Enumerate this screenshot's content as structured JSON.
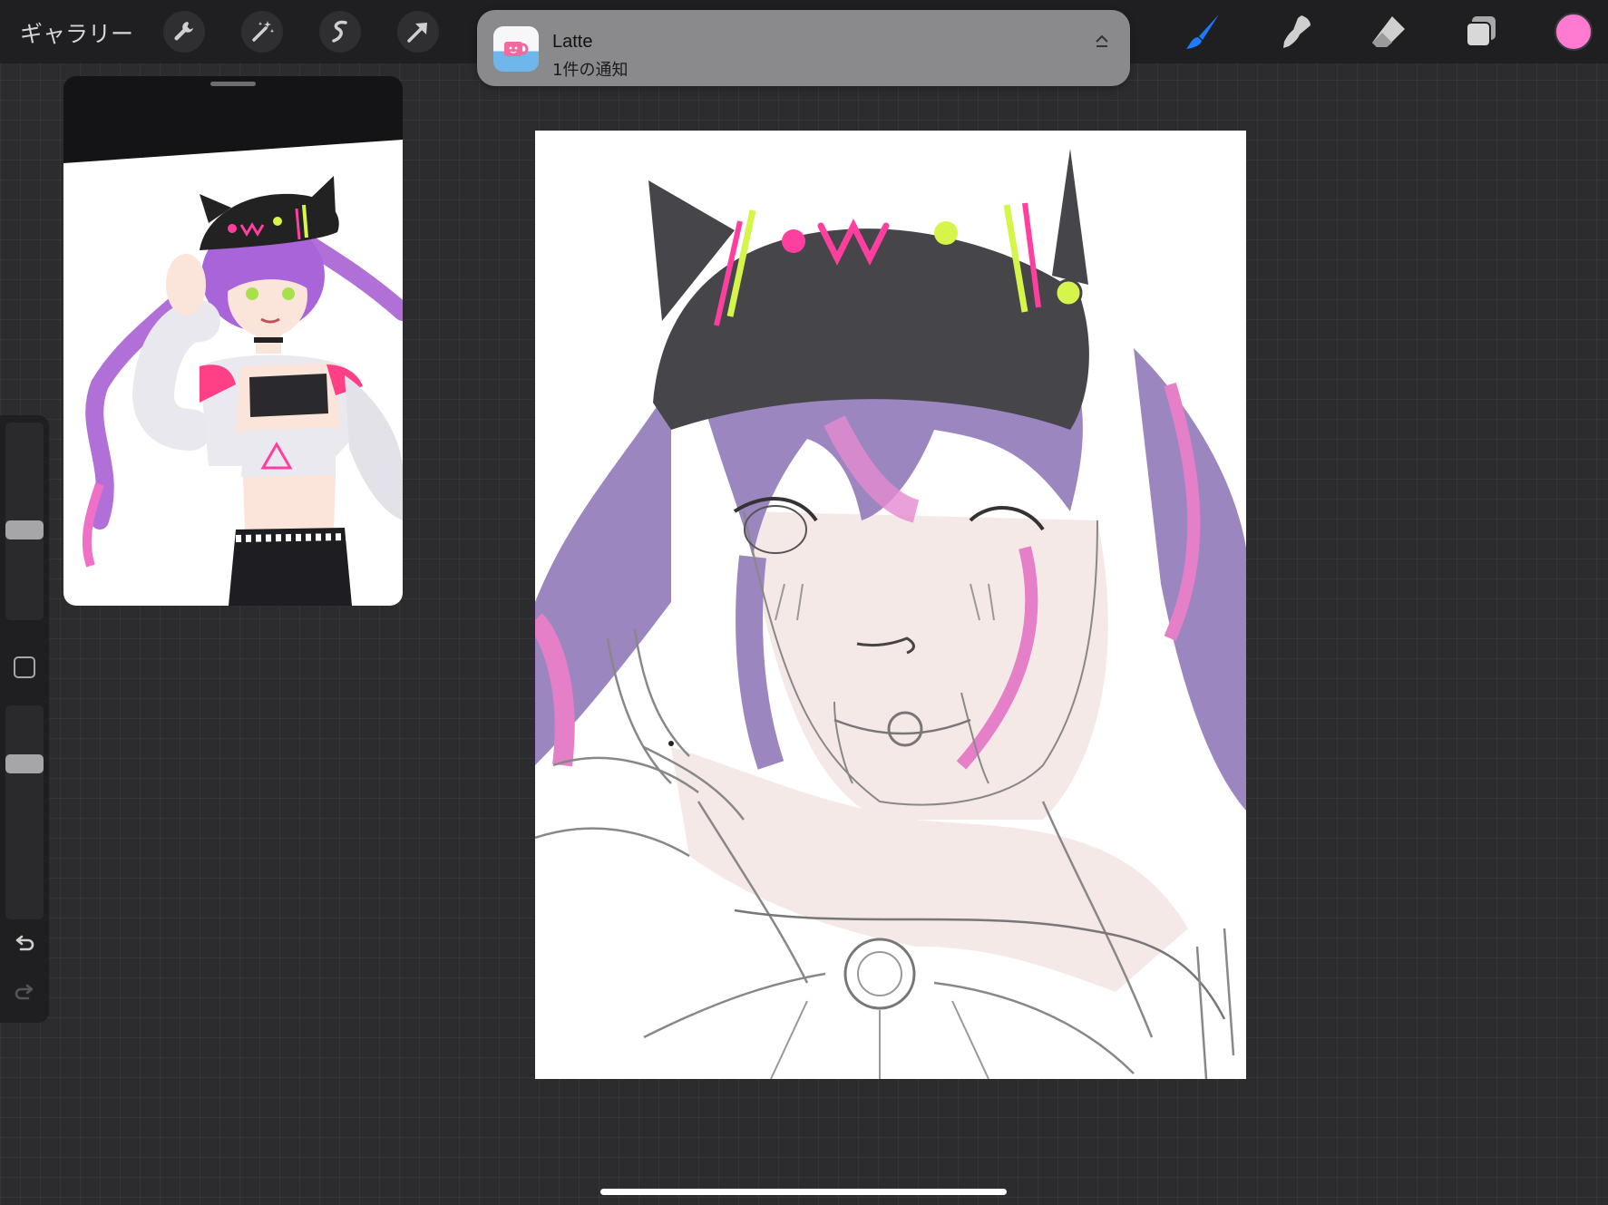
{
  "topbar": {
    "gallery_label": "ギャラリー",
    "left_tools": [
      "wrench-icon",
      "magic-wand-icon",
      "selection-icon",
      "transform-arrow-icon"
    ],
    "right_tools": [
      "brush-icon",
      "smudge-icon",
      "eraser-icon",
      "layers-icon"
    ],
    "active_tool": "brush-icon",
    "accent": "#1c7cff",
    "current_color": "#ff7ad0"
  },
  "notification": {
    "app_name": "Latte",
    "message": "1件の通知",
    "icon": "latte-app-icon"
  },
  "sidebar": {
    "icons": [
      "modify-square-icon",
      "undo-icon",
      "redo-icon"
    ],
    "size_level": 0.45,
    "opacity_level": 0.75
  },
  "reference_panel": {
    "icon": "reference-image"
  },
  "canvas": {
    "content": "sketch-artwork",
    "palette": {
      "hair": "#9b86c0",
      "hair_pink": "#e57fc8",
      "hat": "#45454a",
      "accent_pink": "#ff3fa0",
      "accent_lime": "#d6f54a",
      "skin": "#f3e5e3"
    }
  }
}
